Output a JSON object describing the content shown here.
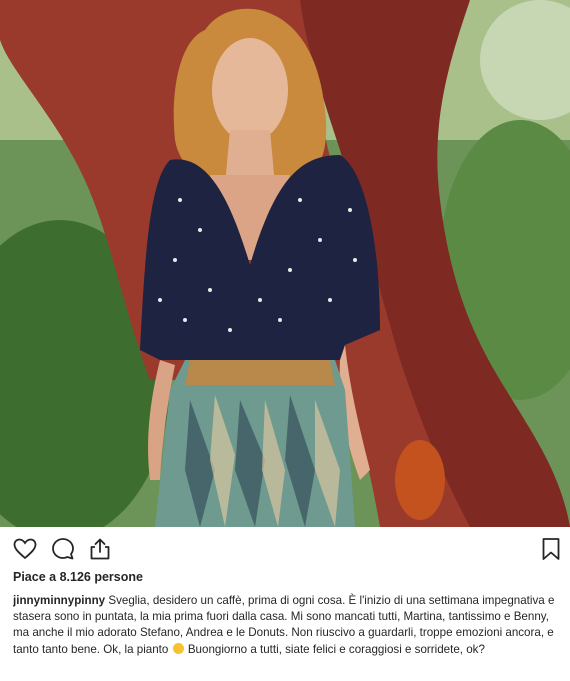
{
  "post": {
    "likes_text": "Piace a 8.126 persone",
    "username": "jinnyminnypinny",
    "caption": "Sveglia, desidero un caffè, prima di ogni cosa. È l'inizio di una settimana impegnativa e stasera sono in puntata, la mia prima fuori dalla casa. Mi sono mancati tutti, Martina, tantissimo e Benny, ma anche il mio adorato Stefano, Andrea e le Donuts. Non riuscivo a guardarli, troppe emozioni ancora, e tanto tanto bene. Ok, la pianto",
    "caption_end": "Buongiorno a tutti, siate felici e coraggiosi e sorridete, ok?",
    "emoji": "smiling-face-emoji"
  },
  "icons": {
    "like": "heart-icon",
    "comment": "comment-icon",
    "share": "share-icon",
    "save": "bookmark-icon"
  }
}
